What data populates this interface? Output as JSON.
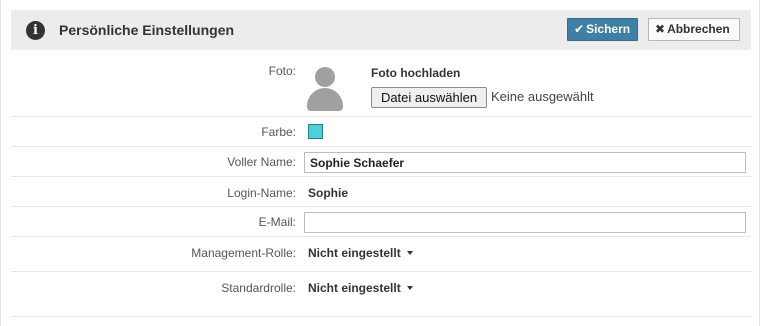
{
  "header": {
    "title": "Persönliche Einstellungen",
    "save_label": "Sichern",
    "cancel_label": "Abbrechen"
  },
  "form": {
    "photo": {
      "label": "Foto:",
      "upload_title": "Foto hochladen",
      "file_button": "Datei auswählen",
      "file_status": "Keine ausgewählt"
    },
    "color": {
      "label": "Farbe:",
      "value": "#4dd0da"
    },
    "full_name": {
      "label": "Voller Name:",
      "value": "Sophie Schaefer"
    },
    "login_name": {
      "label": "Login-Name:",
      "value": "Sophie"
    },
    "email": {
      "label": "E-Mail:",
      "value": ""
    },
    "management_role": {
      "label": "Management-Rolle:",
      "value": "Nicht eingestellt"
    },
    "default_role": {
      "label": "Standardrolle:",
      "value": "Nicht eingestellt"
    }
  },
  "icons": {
    "header": "info-icon",
    "save": "check-icon",
    "cancel": "close-icon",
    "avatar": "user-avatar-icon",
    "dropdown": "caret-down-icon"
  },
  "colors": {
    "save_button": "#3f7fa3",
    "header_bg": "#ececec",
    "avatar": "#a0a0a0"
  }
}
